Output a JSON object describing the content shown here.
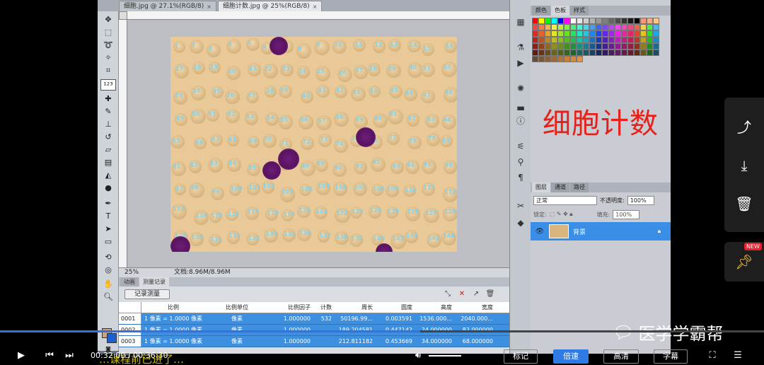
{
  "tabs": [
    {
      "label": "细胞.jpg @ 27.1%(RGB/8)",
      "close": "×"
    },
    {
      "label": "细胞计数.jpg @ 25%(RGB/8)",
      "close": "×"
    }
  ],
  "status": {
    "zoom": "25%",
    "doc": "文档:8.96M/8.96M"
  },
  "panel": {
    "tabs": [
      "动画",
      "测量记录"
    ],
    "record_button": "记录测量",
    "columns": [
      "",
      "比例",
      "比例单位",
      "比例因子",
      "计数",
      "周长",
      "圆度",
      "高度",
      "宽度"
    ],
    "rows": [
      [
        "0001",
        "1 像素 = 1.0000 像素",
        "像素",
        "1.000000",
        "532",
        "50196.99...",
        "0.003591",
        "1536.000...",
        "2040.000..."
      ],
      [
        "0002",
        "1 像素 = 1.0000 像素",
        "像素",
        "1.000000",
        "",
        "189.204581",
        "0.447142",
        "24.000000",
        "82.000000"
      ],
      [
        "0003",
        "1 像素 = 1.0000 像素",
        "像素",
        "1.000000",
        "",
        "212.811182",
        "0.453669",
        "34.000000",
        "68.000000"
      ]
    ]
  },
  "swatch_tabs": [
    "颜色",
    "色板",
    "样式"
  ],
  "overlay_title": "细胞计数",
  "layers": {
    "tabs": [
      "图层",
      "通道",
      "路径"
    ],
    "blend": "正常",
    "opacity_label": "不透明度:",
    "opacity": "100%",
    "lock_label": "锁定:",
    "fill_label": "填充:",
    "fill": "100%",
    "layer_name": "背景"
  },
  "video": {
    "time": "00:32:00 / 00:36:30",
    "progress": 0.55,
    "mark": "标记",
    "speed": "倍速",
    "quality": "高清",
    "subtitle_btn": "字幕",
    "subtitle": "…课程前已进了…"
  },
  "watermark": "医学学霸帮",
  "share_new": "NEW",
  "colors": {
    "accent": "#3b6fe0",
    "title_red": "#e8201a",
    "layer_select": "#3a8ee6"
  },
  "cell_numbers": [
    "1",
    "2",
    "3",
    "4",
    "5",
    "6",
    "7",
    "8",
    "9",
    "10",
    "11",
    "12",
    "13",
    "14",
    "15",
    "16",
    "17",
    "18",
    "19",
    "20",
    "21",
    "22",
    "23",
    "24",
    "25",
    "26",
    "27",
    "28",
    "29",
    "30",
    "31",
    "32",
    "33",
    "34",
    "35",
    "36",
    "37",
    "38",
    "39",
    "40",
    "41",
    "42",
    "43",
    "44",
    "45",
    "46",
    "47",
    "48",
    "49",
    "50",
    "51",
    "52",
    "53",
    "54",
    "55",
    "56",
    "57",
    "58",
    "59",
    "60",
    "61",
    "62",
    "63",
    "64",
    "65",
    "66",
    "67",
    "68",
    "69",
    "70",
    "71",
    "72",
    "73",
    "74",
    "75",
    "76",
    "77",
    "78",
    "79",
    "80",
    "81",
    "82",
    "83",
    "84",
    "85",
    "86",
    "87",
    "88",
    "89",
    "90",
    "91",
    "92",
    "93",
    "94",
    "95",
    "96",
    "97",
    "98",
    "99",
    "100",
    "101",
    "102",
    "103",
    "104",
    "105",
    "106",
    "107",
    "108",
    "109",
    "110",
    "111",
    "112",
    "113",
    "114",
    "115",
    "116",
    "117",
    "118",
    "119",
    "120",
    "121",
    "122",
    "123",
    "124",
    "125",
    "126",
    "127",
    "128",
    "129",
    "130",
    "131",
    "132",
    "133",
    "134",
    "135",
    "136",
    "137",
    "138",
    "139",
    "140",
    "141",
    "142",
    "143",
    "144"
  ]
}
